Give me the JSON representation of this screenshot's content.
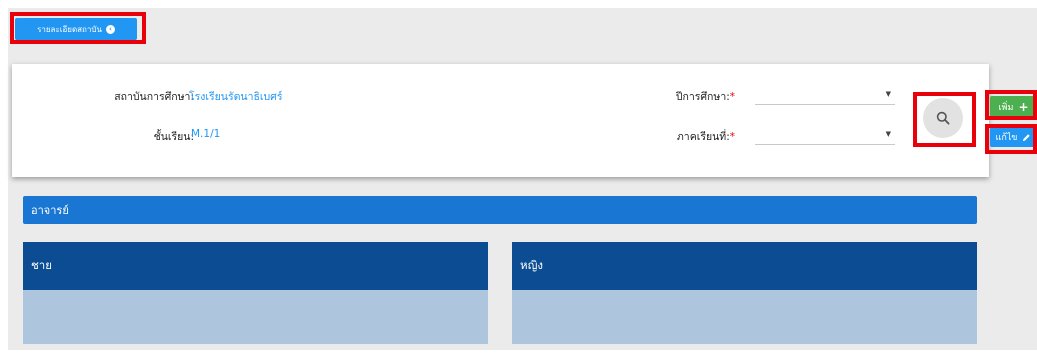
{
  "header": {
    "info_button_label": "รายละเอียดสถาบัน"
  },
  "filters": {
    "institution_label": "สถาบันการศึกษา:",
    "institution_value": "โรงเรียนรัตนาธิเบศร์",
    "class_label": "ชั้นเรียน:",
    "class_value": "M.1/1",
    "academic_year_label": "ปีการศึกษา:",
    "semester_label": "ภาคเรียนที่:",
    "required_mark": "*",
    "academic_year_value": "",
    "semester_value": ""
  },
  "actions": {
    "add_label": "เพิ่ม",
    "edit_label": "แก้ไข"
  },
  "sections": {
    "teacher_title": "อาจารย์",
    "male_title": "ชาย",
    "female_title": "หญิง"
  },
  "colors": {
    "primary": "#2196f3",
    "success": "#4caf50",
    "header_blue": "#1976d2",
    "panel_dark": "#0b4c93",
    "panel_light": "#aec5de",
    "highlight": "#e8000b"
  },
  "icons": {
    "info": "info-circle-icon",
    "search": "search-icon",
    "add": "plus-icon",
    "edit": "pencil-icon",
    "dropdown": "caret-down-icon"
  }
}
